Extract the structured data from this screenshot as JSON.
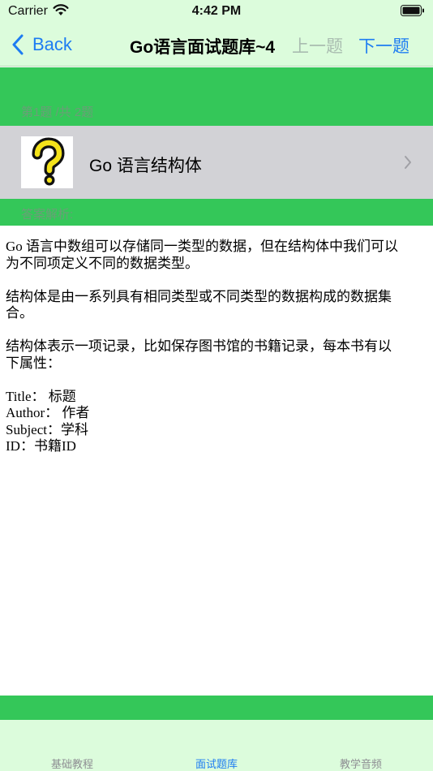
{
  "status_bar": {
    "carrier": "Carrier",
    "time": "4:42 PM",
    "wifi_icon": "wifi-icon",
    "battery_icon": "battery-icon"
  },
  "nav": {
    "back_label": "Back",
    "title": "Go语言面试题库~4",
    "prev_label": "上一题",
    "next_label": "下一题"
  },
  "question": {
    "index_text": "第1题 /共 2题",
    "icon": "question-mark-icon",
    "title": "Go 语言结构体"
  },
  "answer": {
    "label": "答案解析:",
    "paragraphs": [
      [
        "Go 语言中数组可以存储同一类型的数据，但在结构体中我们可以",
        "为不同项定义不同的数据类型。"
      ],
      [
        "结构体是由一系列具有相同类型或不同类型的数据构成的数据集",
        "合。"
      ],
      [
        "结构体表示一项记录，比如保存图书馆的书籍记录，每本书有以",
        "下属性："
      ],
      [
        "Title： 标题",
        "Author： 作者",
        "Subject：学科",
        "ID：书籍ID"
      ]
    ]
  },
  "tabs": [
    {
      "label": "基础教程",
      "active": false
    },
    {
      "label": "面试题库",
      "active": true
    },
    {
      "label": "教学音频",
      "active": false
    }
  ],
  "colors": {
    "accent": "#1d7cf2",
    "green": "#34c759",
    "bar_bg": "#dcfcdc",
    "row_bg": "#d2d2d6"
  }
}
